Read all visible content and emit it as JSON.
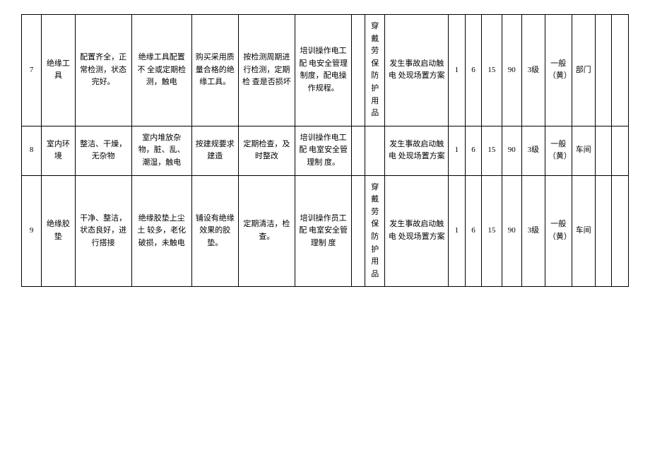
{
  "rows": [
    {
      "num": "7",
      "name": "绝缘工具",
      "c1": "配置齐全，正常检测，状态完好。",
      "c2": "绝缘工具配置不 全或定期检测，触电",
      "c3": "购买采用质量合格的绝缘工具。",
      "c4": "按检测周期进 行检测，定期检 查是否损坏",
      "c5": "培训操作电工配 电安全管理制度，配电操作规程。",
      "c6": "",
      "c7": "穿戴劳保防护用品",
      "c8": "发生事故启动触电 处现场置方案",
      "n1": "1",
      "n2": "6",
      "n3": "15",
      "n4": "90",
      "level": "3级",
      "color": "一般（黄）",
      "dept": "部门",
      "x1": "",
      "x2": ""
    },
    {
      "num": "8",
      "name": "室内环境",
      "c1": "整洁、干燥，无杂物",
      "c2": "室内堆放杂物，脏、乱、潮湿，触电",
      "c3": "按建规要求建造",
      "c4": "定期检查，及时整改",
      "c5": "培训操作电工配 电室安全管理制 度。",
      "c6": "",
      "c7": "",
      "c8": "发生事故启动触电 处现场置方案",
      "n1": "1",
      "n2": "6",
      "n3": "15",
      "n4": "90",
      "level": "3级",
      "color": "一般（黄）",
      "dept": "车间",
      "x1": "",
      "x2": ""
    },
    {
      "num": "9",
      "name": "绝缘胶垫",
      "c1": "干净、整洁，状态良好，进行搭接",
      "c2": "绝缘胶垫上尘土 较多，老化破损，未触电",
      "c3": "铺设有绝缘效果的胶 垫。",
      "c4": "定期清洁，检查。",
      "c5": "培训操作员工配 电室安全管理制 度",
      "c6": "",
      "c7": "穿戴劳保防护用品",
      "c8": "发生事故启动触电 处现场置方案",
      "n1": "1",
      "n2": "6",
      "n3": "15",
      "n4": "90",
      "level": "3级",
      "color": "一般（黄）",
      "dept": "车间",
      "x1": "",
      "x2": ""
    }
  ]
}
